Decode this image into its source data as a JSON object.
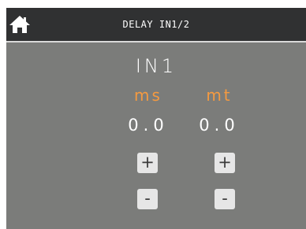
{
  "header": {
    "title": "DELAY IN1/2",
    "home_icon": "home-icon"
  },
  "channel": {
    "label": "IN1"
  },
  "columns": [
    {
      "label": "ms",
      "value": "0.0",
      "plus": "+",
      "minus": "-"
    },
    {
      "label": "mt",
      "value": "0.0",
      "plus": "+",
      "minus": "-"
    }
  ],
  "colors": {
    "header_bg": "#303132",
    "panel_bg": "#7b7c7a",
    "accent": "#f59a40",
    "button_bg": "#e6e6e6"
  }
}
